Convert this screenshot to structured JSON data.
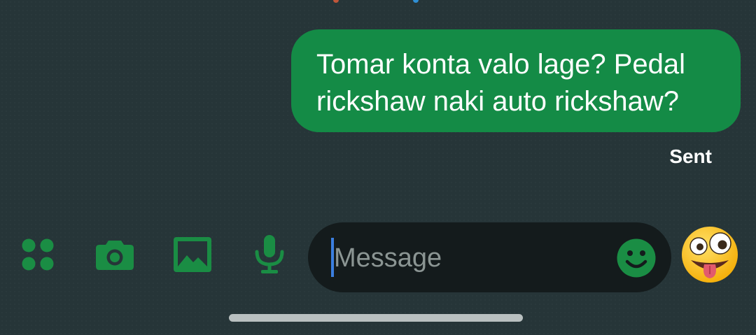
{
  "conversation": {
    "outgoing_message": {
      "lines": [
        "Tomar konta valo lage? Pedal",
        "rickshaw naki auto rickshaw?"
      ],
      "status": "Sent"
    }
  },
  "composer": {
    "placeholder": "Message",
    "value": ""
  },
  "toolbar": {
    "icons": [
      "apps-icon",
      "camera-icon",
      "gallery-icon",
      "microphone-icon",
      "emoji-picker-icon",
      "sticker-emoji-icon"
    ]
  },
  "colors": {
    "background": "#263538",
    "bubble": "#148b46",
    "accent_green": "#1a8d44",
    "composer": "#141b1c",
    "cursor": "#3b7fe0",
    "text": "#ffffff"
  }
}
